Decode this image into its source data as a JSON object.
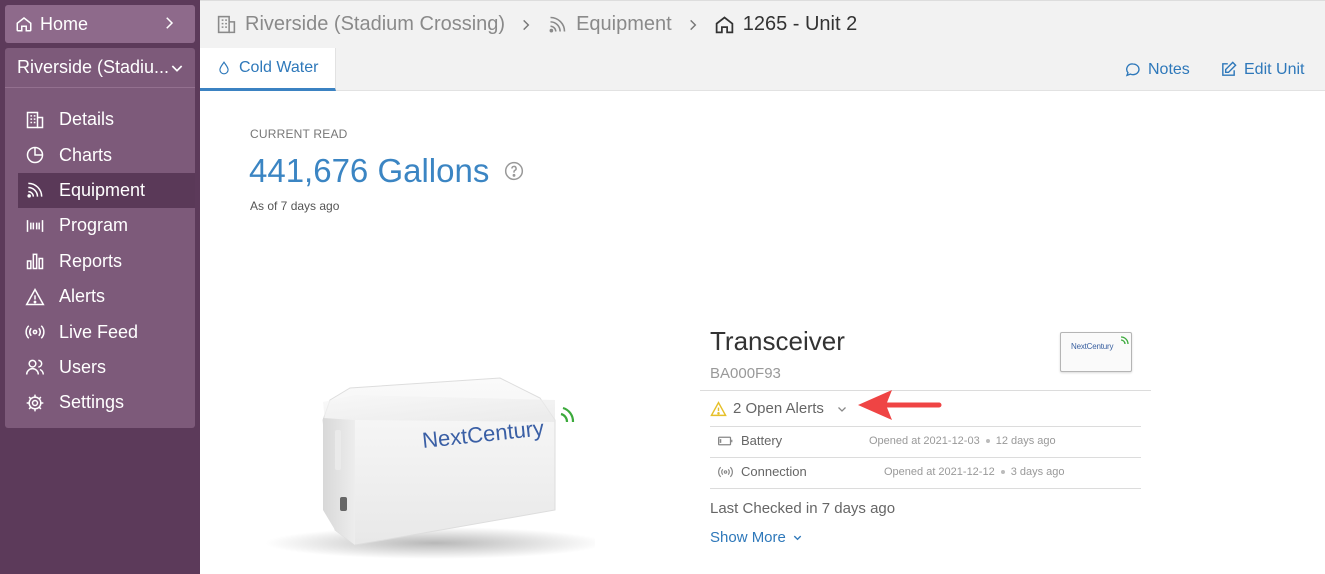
{
  "sidebar": {
    "home_label": "Home",
    "site_name": "Riverside (Stadiu...",
    "items": [
      {
        "label": "Details",
        "icon": "building-icon"
      },
      {
        "label": "Charts",
        "icon": "pie-chart-icon"
      },
      {
        "label": "Equipment",
        "icon": "signal-icon",
        "active": true
      },
      {
        "label": "Program",
        "icon": "barcode-icon"
      },
      {
        "label": "Reports",
        "icon": "bar-chart-icon"
      },
      {
        "label": "Alerts",
        "icon": "warning-icon"
      },
      {
        "label": "Live Feed",
        "icon": "broadcast-icon"
      },
      {
        "label": "Users",
        "icon": "users-icon"
      },
      {
        "label": "Settings",
        "icon": "gear-icon"
      }
    ]
  },
  "breadcrumb": {
    "site": "Riverside (Stadium Crossing)",
    "section": "Equipment",
    "unit": "1265 - Unit 2"
  },
  "tabs": {
    "active": "Cold Water",
    "notes": "Notes",
    "edit_unit": "Edit Unit"
  },
  "reading": {
    "label": "CURRENT READ",
    "value": "441,676 Gallons",
    "as_of": "As of 7 days ago"
  },
  "device": {
    "brand_logo_text": "NextCentury"
  },
  "transceiver": {
    "title": "Transceiver",
    "serial": "BA000F93",
    "logo_text": "NextCentury",
    "open_alerts": "2 Open Alerts",
    "alerts": [
      {
        "name": "Battery",
        "opened": "Opened at 2021-12-03",
        "ago": "12 days ago"
      },
      {
        "name": "Connection",
        "opened": "Opened at 2021-12-12",
        "ago": "3 days ago"
      }
    ],
    "last_checked": "Last Checked in 7 days ago",
    "show_more": "Show More"
  },
  "colors": {
    "sidebar_bg": "#5c3a5a",
    "sidebar_panel": "#7d5a7a",
    "accent_blue": "#2e78ba",
    "warning_yellow": "#e6c02a",
    "annotation_red": "#ef4444"
  }
}
